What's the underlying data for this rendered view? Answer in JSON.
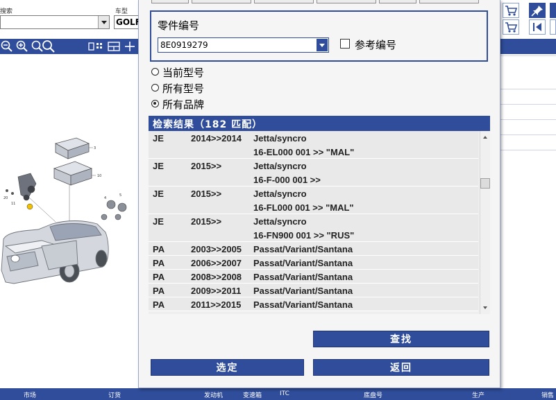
{
  "background": {
    "search_label": "搜索",
    "model_label": "车型",
    "model_value": "GOLF"
  },
  "dialog": {
    "part_number_label": "零件编号",
    "part_number_value": "8E0919279",
    "reference_label": "参考编号",
    "radios": [
      {
        "label": "当前型号",
        "selected": false
      },
      {
        "label": "所有型号",
        "selected": false
      },
      {
        "label": "所有品牌",
        "selected": true
      }
    ],
    "results_title": "检索结果（182 匹配）",
    "results": [
      {
        "code": "JE",
        "years": "2014>>2014",
        "model": "Jetta/syncro",
        "detail": "16-EL000 001 >> \"MAL\""
      },
      {
        "code": "JE",
        "years": "2015>>",
        "model": "Jetta/syncro",
        "detail": "16-F-000 001 >>"
      },
      {
        "code": "JE",
        "years": "2015>>",
        "model": "Jetta/syncro",
        "detail": "16-FL000 001 >> \"MAL\""
      },
      {
        "code": "JE",
        "years": "2015>>",
        "model": "Jetta/syncro",
        "detail": "16-FN900 001 >> \"RUS\""
      },
      {
        "code": "PA",
        "years": "2003>>2005",
        "model": "Passat/Variant/Santana",
        "detail": ""
      },
      {
        "code": "PA",
        "years": "2006>>2007",
        "model": "Passat/Variant/Santana",
        "detail": ""
      },
      {
        "code": "PA",
        "years": "2008>>2008",
        "model": "Passat/Variant/Santana",
        "detail": ""
      },
      {
        "code": "PA",
        "years": "2009>>2011",
        "model": "Passat/Variant/Santana",
        "detail": ""
      },
      {
        "code": "PA",
        "years": "2011>>2015",
        "model": "Passat/Variant/Santana",
        "detail": ""
      }
    ],
    "search_button": "查找",
    "select_button": "选定",
    "back_button": "返回"
  },
  "status_bar": [
    "市场",
    "订货",
    "发动机",
    "变速箱",
    "ITC",
    "底盘号",
    "生产",
    "销售"
  ],
  "icons": {
    "cart": "cart-icon",
    "pin": "pin-icon",
    "first": "first-page-icon",
    "zoom_out": "zoom-out-icon",
    "zoom_in": "zoom-in-icon",
    "search": "search-icon"
  },
  "colors": {
    "accent": "#2f4d9a",
    "row_bg": "#e9e9e9",
    "dialog_bg": "#f5f5f5"
  }
}
